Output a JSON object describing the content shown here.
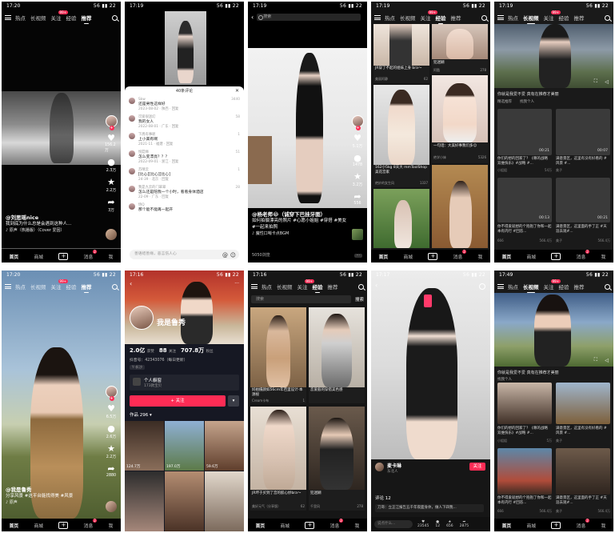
{
  "status": {
    "t1": "17:20",
    "t2": "17:19",
    "t3": "17:19",
    "t4": "17:19",
    "t5": "17:19",
    "t6": "17:20",
    "t7": "17:16",
    "t8": "17:16",
    "t9": "17:17",
    "t10": "17:49",
    "right": "56 ▮▮ 22"
  },
  "tabs": {
    "hot": "热点",
    "long": "长视频",
    "follow": "关注",
    "exp": "经验",
    "rec": "推荐",
    "badge": "99+"
  },
  "nav": {
    "home": "首页",
    "mall": "商城",
    "plus": "+",
    "msg": "消息",
    "me": "我",
    "msg_badge": "2"
  },
  "shot1": {
    "user": "@刘思瑶nice",
    "caption": "我到底为什么总是会遇到这种人...",
    "music": "♪ 原声（热播版）（Cover 爱因）",
    "likes": "156.2万",
    "comments": "2.3万",
    "stars": "2.2万",
    "shares": "3万"
  },
  "shot2": {
    "title": "40条评论",
    "input_ph": "善语结善缘，恶言伤人心",
    "comments": [
      {
        "name": "Skw",
        "text": "还是男性这样好",
        "meta": "2023-08-02 · 陕西 · 回复",
        "likes": "3440"
      },
      {
        "name": "可爱很迷幻",
        "text": "我的女人",
        "meta": "2022-08-01 · 广东 · 回复",
        "likes": "58"
      },
      {
        "name": "下周有事呢",
        "text": "上小美有啊",
        "meta": "2021-11 · 福建 · 回复",
        "likes": "1"
      },
      {
        "name": "悦菇缘",
        "text": "怎么变漂亮？？？",
        "meta": "2022-09-01 · 浙江 · 回复",
        "likes": "51"
      },
      {
        "name": "苏晴云",
        "text": "[比心][比心][比心]",
        "meta": "24-39 · 北京 · 回复",
        "likes": "1"
      },
      {
        "name": "我是九云的门翠翠",
        "text": "怎么还是陪我一个小时，看看身体酒店",
        "meta": "22-09 · 广东 · 回复",
        "likes": "28"
      },
      {
        "name": "悟Q",
        "text": "那个能不能再一起开",
        "meta": "",
        "likes": ""
      }
    ]
  },
  "shot3": {
    "search_ph": "搜索",
    "user": "@杨老师😂（诚穿下巴挂牙图）",
    "caption": "如何拍摄漂亮的照片 #心愿小姐姐 #穿搭 #美女 #一起来拍照",
    "music": "♪ 魔性口哨卡点BGM",
    "watch": "5050浏览",
    "likes": "5.1万",
    "comments": "1478",
    "stars": "3.2万",
    "shares": "556"
  },
  "shot4": {
    "cards": [
      {
        "title": "JR穿了不起的姐妹上身 bra～",
        "author": "美丽阿静",
        "likes": "62"
      },
      {
        "title": "犯迷糊",
        "author": "阿酷",
        "likes": "278"
      },
      {
        "title": "162小5kg 8天大 mmToolShop 美花宫家",
        "author": "绝妙的女生风",
        "likes": "1337"
      },
      {
        "title": "一句话：大美好事我们多☺",
        "author": "绝学小妹",
        "likes": "5326"
      },
      {
        "title": "",
        "author": "",
        "likes": ""
      },
      {
        "title": "",
        "author": "",
        "likes": ""
      }
    ]
  },
  "shot5": {
    "rec_title": "你就是我爱不爱 真有在推荐才美丽",
    "tags": [
      "精选推荐",
      "找我个人"
    ],
    "cards": [
      {
        "title": "你们的想的回家了？《尊的战略 双维快乐》#战略 #...",
        "author": "小姐姐",
        "likes": "54万",
        "dur": "00:21"
      },
      {
        "title": "满意景区，这里有没有好看的 #风景 #...",
        "author": "美子",
        "likes": "",
        "dur": "00:07"
      },
      {
        "title": "你不得爱就想的个抱抱了你和一起本有内行 #回答...",
        "author": "666",
        "likes": "566.4万",
        "dur": "00:13"
      },
      {
        "title": "满意景区，这里面的手了正 #天涯去观#...",
        "author": "美子",
        "likes": "566.4万",
        "dur": "00:21"
      }
    ]
  },
  "shot6": {
    "user": "@我是鲁秀",
    "caption": "分享风景 #这平台能找得美 #风景",
    "music": "♪ 原声",
    "likes": "6.5万",
    "comments": "2.6万",
    "stars": "2.2万",
    "shares": "2880"
  },
  "shot7": {
    "name": "我是鲁秀",
    "stats": [
      {
        "v": "2.0亿",
        "k": "获赞"
      },
      {
        "v": "88",
        "k": "关注"
      },
      {
        "v": "707.8万",
        "k": "粉丝"
      }
    ],
    "bio": "抖音号：42343076（每日更新）",
    "fans": "Y·长沙",
    "shop": "个人橱窗",
    "shop_sub": "173款宝贝",
    "follow_btn": "+ 关注",
    "works": "作品 296 ▾",
    "plays": [
      "124.7万",
      "197.0万",
      "59.6万",
      "",
      "",
      ""
    ]
  },
  "shot8": {
    "search_ph": "搜索",
    "search_btn": "搜索",
    "cards": [
      {
        "title": "妈拍摄颜如56cm年芭里设计·本源视",
        "author": "Cream卡布",
        "likes": "1"
      },
      {
        "title": "恋爱般的穿搭美色感",
        "author": "",
        "likes": ""
      },
      {
        "title": "JR坏于买到了宫的胶心妙bra～",
        "author": "美好元气（分享版）",
        "likes": "62"
      },
      {
        "title": "犯迷糊",
        "author": "千里风 ",
        "likes": "278"
      }
    ]
  },
  "shot9": {
    "user": "麦卡琳",
    "follow": "关注",
    "sub": "东北人",
    "comments_count": "评论 12",
    "comment": "刀哥：立正江报告五千年夜面身体，做人下四我...",
    "input_ph": "说点什么...",
    "likes": "23545",
    "cm": "12",
    "st": "656",
    "sh": "2875"
  },
  "shot10": {
    "rec_title": "你就是我爱不爱 真有在推荐才美丽",
    "tags": [
      "找我个人"
    ],
    "cards": [
      {
        "title": "你们的想的回家了？《尊的战略 双维快乐》#战略 #...",
        "author": "小姐姐",
        "likes": "5万"
      },
      {
        "title": "满意景区，这里有没有好看的 #风景 #...",
        "author": "美子",
        "likes": ""
      },
      {
        "title": "你不得爱就想的个抱抱了你和一起本有内行 #回答...",
        "author": "666",
        "likes": "566.4万"
      },
      {
        "title": "满意景区，这里面的手了正 #天涯去观#...",
        "author": "美子",
        "likes": "566.4万"
      }
    ]
  }
}
